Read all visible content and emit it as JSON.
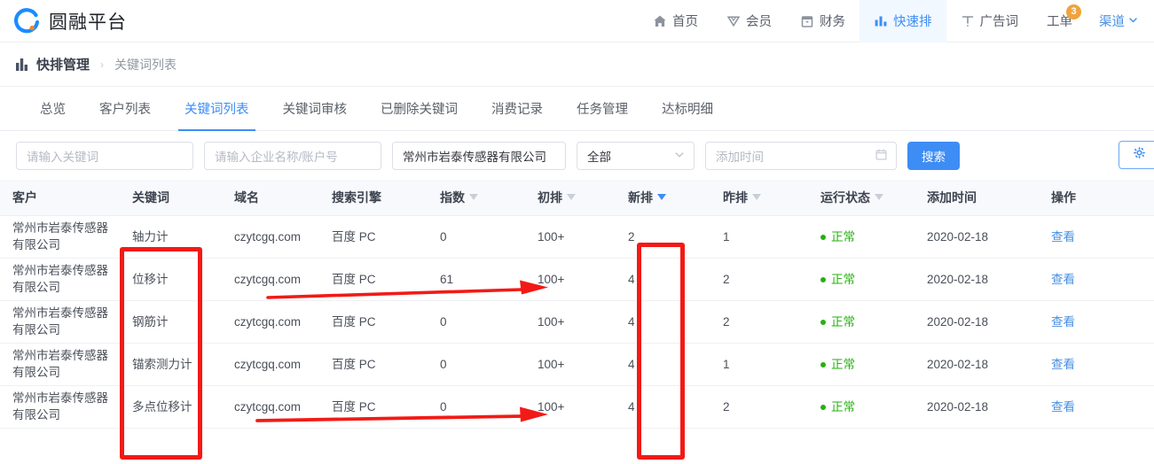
{
  "brand": {
    "name": "圆融平台",
    "logo_icon": "circle-logo-icon",
    "accent": "#1a8cff",
    "dot_color": "#f5822b"
  },
  "header": {
    "nav": [
      {
        "label": "首页",
        "icon": "home-icon",
        "active": false
      },
      {
        "label": "会员",
        "icon": "diamond-icon",
        "active": false
      },
      {
        "label": "财务",
        "icon": "wallet-icon",
        "active": false
      },
      {
        "label": "快速排",
        "icon": "bar-chart-icon",
        "active": true
      },
      {
        "label": "广告词",
        "icon": "text-t-icon",
        "active": false
      },
      {
        "label": "工单",
        "icon": "ticket-icon",
        "active": false,
        "badge": "3"
      }
    ],
    "channel": {
      "label": "渠道",
      "icon": "chevron-down-icon"
    },
    "badge_color": "#f0a33c",
    "active_color": "#3d8df5"
  },
  "breadcrumb": {
    "icon": "bar-chart-icon",
    "title": "快排管理",
    "separator": "›",
    "current": "关键词列表"
  },
  "tabs": [
    {
      "label": "总览",
      "active": false
    },
    {
      "label": "客户列表",
      "active": false
    },
    {
      "label": "关键词列表",
      "active": true
    },
    {
      "label": "关键词审核",
      "active": false
    },
    {
      "label": "已删除关键词",
      "active": false
    },
    {
      "label": "消费记录",
      "active": false
    },
    {
      "label": "任务管理",
      "active": false
    },
    {
      "label": "达标明细",
      "active": false
    }
  ],
  "filters": {
    "keyword": {
      "value": "",
      "placeholder": "请输入关键词"
    },
    "account": {
      "value": "",
      "placeholder": "请输入企业名称/账户号"
    },
    "company": {
      "value": "常州市岩泰传感器有限公司",
      "placeholder": ""
    },
    "scope": {
      "value": "全部",
      "icon": "chevron-down-icon"
    },
    "date": {
      "value": "",
      "placeholder": "添加时间",
      "icon": "calendar-icon"
    },
    "search_button": "搜索",
    "settings_button_icon": "gear-icon"
  },
  "table": {
    "columns": [
      {
        "label": "客户",
        "sortable": false
      },
      {
        "label": "关键词",
        "sortable": false
      },
      {
        "label": "域名",
        "sortable": false
      },
      {
        "label": "搜索引擎",
        "sortable": false
      },
      {
        "label": "指数",
        "sortable": true,
        "sort_active": false
      },
      {
        "label": "初排",
        "sortable": true,
        "sort_active": false
      },
      {
        "label": "新排",
        "sortable": true,
        "sort_active": true
      },
      {
        "label": "昨排",
        "sortable": true,
        "sort_active": false
      },
      {
        "label": "运行状态",
        "sortable": true,
        "sort_active": false
      },
      {
        "label": "添加时间",
        "sortable": false
      },
      {
        "label": "操作",
        "sortable": false
      }
    ],
    "rows": [
      {
        "customer": "常州市岩泰传感器有限公司",
        "keyword": "轴力计",
        "domain": "czytcgq.com",
        "engine": "百度 PC",
        "index": "0",
        "first_rank": "100+",
        "new_rank": "2",
        "yest_rank": "1",
        "status": "正常",
        "added": "2020-02-18",
        "action": "查看"
      },
      {
        "customer": "常州市岩泰传感器有限公司",
        "keyword": "位移计",
        "domain": "czytcgq.com",
        "engine": "百度 PC",
        "index": "61",
        "first_rank": "100+",
        "new_rank": "4",
        "yest_rank": "2",
        "status": "正常",
        "added": "2020-02-18",
        "action": "查看"
      },
      {
        "customer": "常州市岩泰传感器有限公司",
        "keyword": "钢筋计",
        "domain": "czytcgq.com",
        "engine": "百度 PC",
        "index": "0",
        "first_rank": "100+",
        "new_rank": "4",
        "yest_rank": "2",
        "status": "正常",
        "added": "2020-02-18",
        "action": "查看"
      },
      {
        "customer": "常州市岩泰传感器有限公司",
        "keyword": "锚索测力计",
        "domain": "czytcgq.com",
        "engine": "百度 PC",
        "index": "0",
        "first_rank": "100+",
        "new_rank": "4",
        "yest_rank": "1",
        "status": "正常",
        "added": "2020-02-18",
        "action": "查看"
      },
      {
        "customer": "常州市岩泰传感器有限公司",
        "keyword": "多点位移计",
        "domain": "czytcgq.com",
        "engine": "百度 PC",
        "index": "0",
        "first_rank": "100+",
        "new_rank": "4",
        "yest_rank": "2",
        "status": "正常",
        "added": "2020-02-18",
        "action": "查看"
      }
    ],
    "status_color": "#25b10f",
    "link_color": "#4a90e2"
  },
  "annotations": {
    "color": "#f21a16",
    "shapes": [
      {
        "name": "keyword-column-highlight",
        "type": "box"
      },
      {
        "name": "new-rank-column-highlight",
        "type": "box"
      },
      {
        "name": "pointer-arrow-top",
        "type": "arrow"
      },
      {
        "name": "pointer-arrow-bottom",
        "type": "arrow"
      }
    ]
  }
}
